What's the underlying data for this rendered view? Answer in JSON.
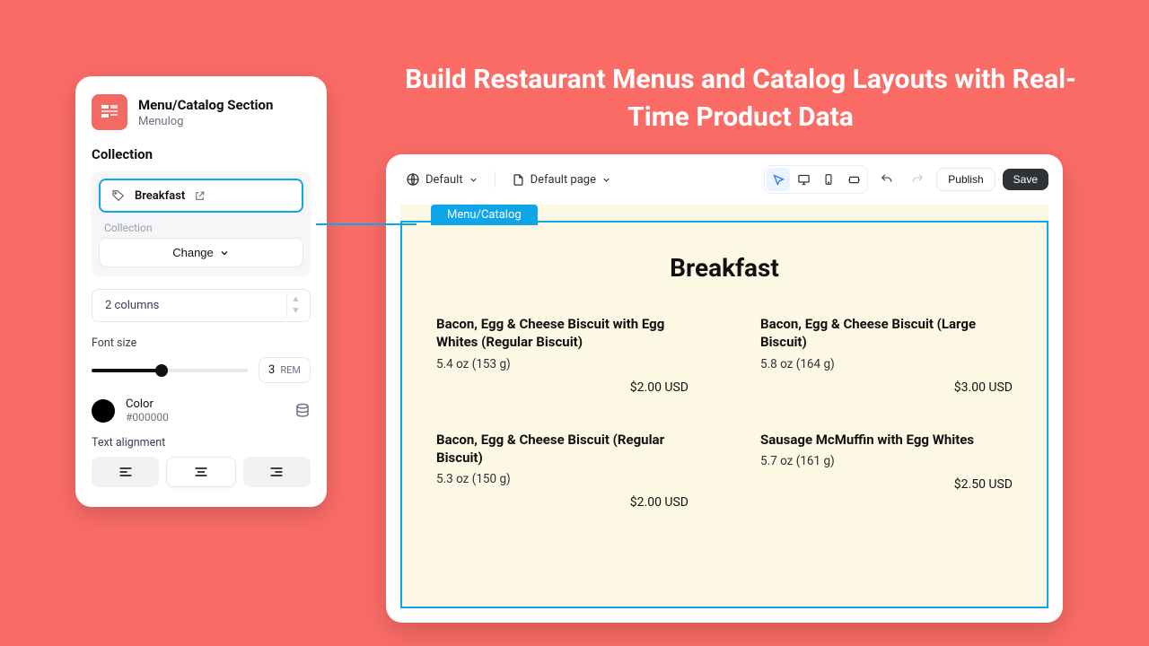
{
  "hero": {
    "title": "Build Restaurant Menus and Catalog Layouts with Real-Time Product Data"
  },
  "settings": {
    "app_name": "Menu/Catalog Section",
    "app_vendor": "Menulog",
    "section_label": "Collection",
    "collection_chip": "Breakfast",
    "collection_subtle": "Collection",
    "change_label": "Change",
    "columns_value": "2 columns",
    "font_size_label": "Font size",
    "font_size_value": "3",
    "font_size_unit": "REM",
    "color_label": "Color",
    "color_value": "#000000",
    "text_alignment_label": "Text alignment"
  },
  "toolbar": {
    "theme_label": "Default",
    "page_label": "Default page",
    "publish_label": "Publish",
    "save_label": "Save"
  },
  "preview": {
    "select_tab": "Menu/Catalog",
    "heading": "Breakfast",
    "items": [
      {
        "name": "Bacon, Egg & Cheese Biscuit with Egg Whites (Regular Biscuit)",
        "weight": "5.4 oz (153 g)",
        "price": "$2.00 USD"
      },
      {
        "name": "Bacon, Egg & Cheese Biscuit (Large Biscuit)",
        "weight": "5.8 oz (164 g)",
        "price": "$3.00 USD"
      },
      {
        "name": "Bacon, Egg & Cheese Biscuit (Regular Biscuit)",
        "weight": "5.3 oz (150 g)",
        "price": "$2.00 USD"
      },
      {
        "name": "Sausage McMuffin with Egg Whites",
        "weight": "5.7 oz (161 g)",
        "price": "$2.50 USD"
      }
    ]
  }
}
